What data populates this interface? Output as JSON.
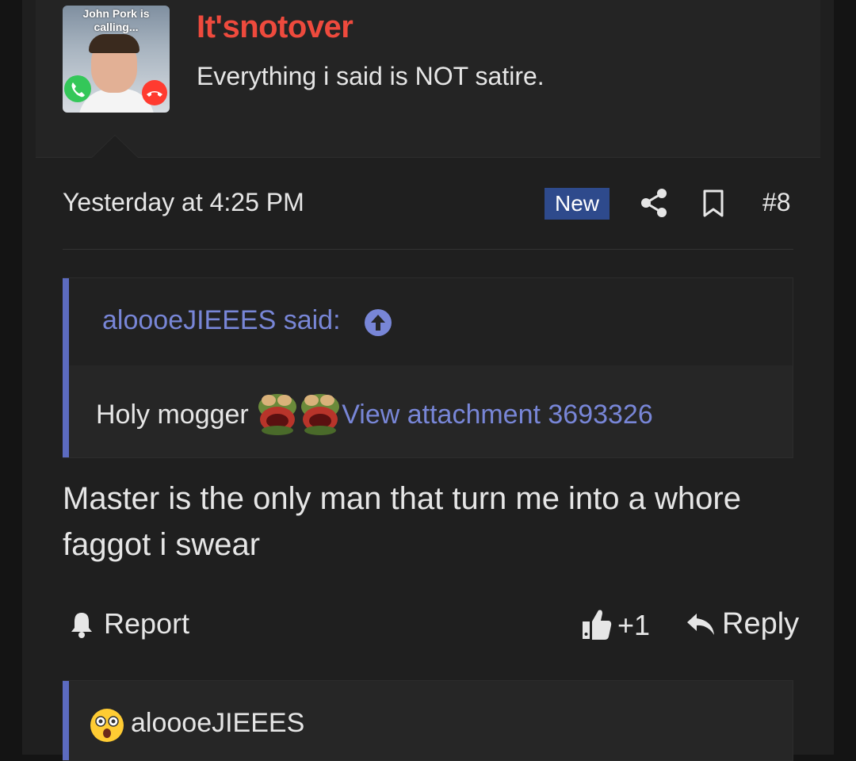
{
  "user": {
    "avatar_caption": "John Pork is calling...",
    "name": "It'snotover",
    "title": "Everything i said is NOT satire."
  },
  "post": {
    "timestamp": "Yesterday at 4:25 PM",
    "badge": "New",
    "number": "#8"
  },
  "quote": {
    "author": "aloooeJIEEES said:",
    "text": "Holy mogger",
    "link": "View attachment 3693326"
  },
  "message": "Master is the only man that turn me into a whore faggot i swear",
  "actions": {
    "report": "Report",
    "like_count": "+1",
    "reply": "Reply"
  },
  "next_quote": {
    "author": "aloooeJIEEES"
  },
  "colors": {
    "background": "#1f1f1f",
    "username": "#ee4a3d",
    "link": "#7886d7",
    "quote_bar": "#5c6bc0",
    "badge": "#2e4a8c"
  },
  "icons": [
    "share-icon",
    "bookmark-icon",
    "arrow-up-circle-icon",
    "pepe-emoji-icon",
    "bell-icon",
    "thumbs-up-icon",
    "reply-arrow-icon",
    "shocked-emoji-icon"
  ]
}
